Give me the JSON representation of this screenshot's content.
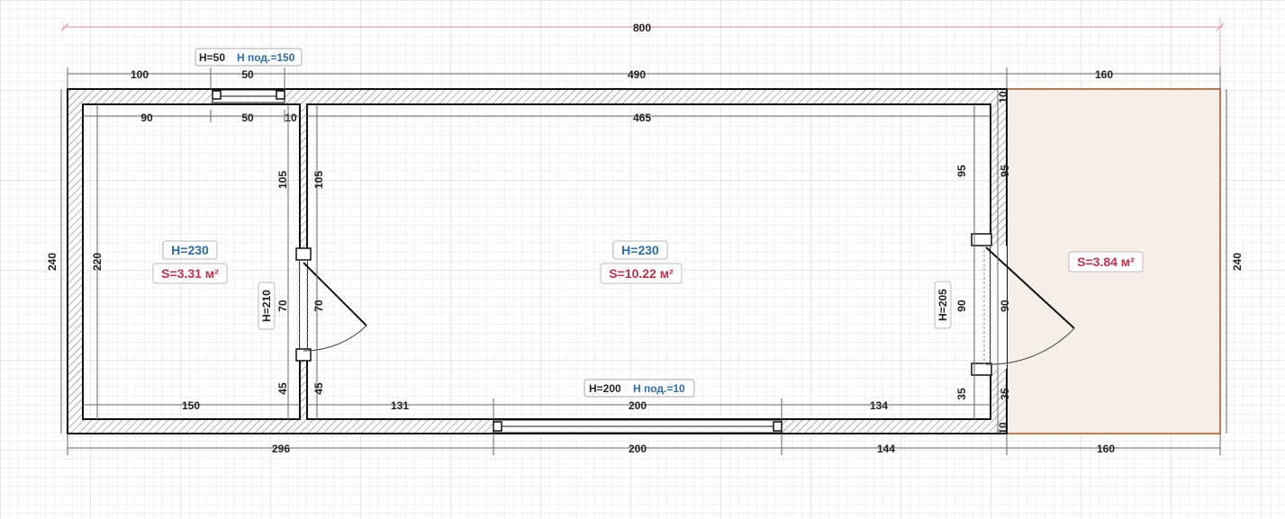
{
  "colors": {
    "dimension_text": "#222222",
    "height_label": "#2b6ca8",
    "area_label": "#c0304a",
    "sill_label": "#2b6ca8",
    "overall_dim_line": "#e08898",
    "terrace_fill": "#f7eeea",
    "terrace_border": "#b87a52",
    "wall_stroke": "#111111"
  },
  "overall": {
    "length": "800"
  },
  "top": {
    "segments": [
      "100",
      "50",
      "490",
      "160"
    ],
    "window": {
      "height": "H=50",
      "sill": "H под.=150"
    }
  },
  "bottom": {
    "segments": [
      "296",
      "200",
      "144",
      "160"
    ],
    "window": {
      "height": "H=200",
      "sill": "H под.=10"
    }
  },
  "left_room": {
    "height": "H=230",
    "area": "S=3.31 м²",
    "width_top_left": "90",
    "width_window": "50",
    "wall_gap": "10",
    "width_bottom": "150",
    "depth": "220"
  },
  "main_room": {
    "height": "H=230",
    "area": "S=10.22 м²",
    "width_top": "465",
    "width_bottom_left": "131",
    "width_bottom_window": "200",
    "width_bottom_right": "134"
  },
  "terrace": {
    "area": "S=3.84 м²",
    "depth": "240"
  },
  "left_side": {
    "depth": "240"
  },
  "inner_door": {
    "height": "H=210",
    "left_upper": "105",
    "right_upper": "105",
    "left_opening": "70",
    "right_opening": "70",
    "left_lower": "45",
    "right_lower": "45"
  },
  "outer_door": {
    "height": "H=205",
    "top_wall": "10",
    "left_upper": "95",
    "right_upper": "95",
    "left_opening": "90",
    "right_opening": "90",
    "left_lower": "35",
    "right_lower": "35",
    "bottom_wall": "10"
  }
}
